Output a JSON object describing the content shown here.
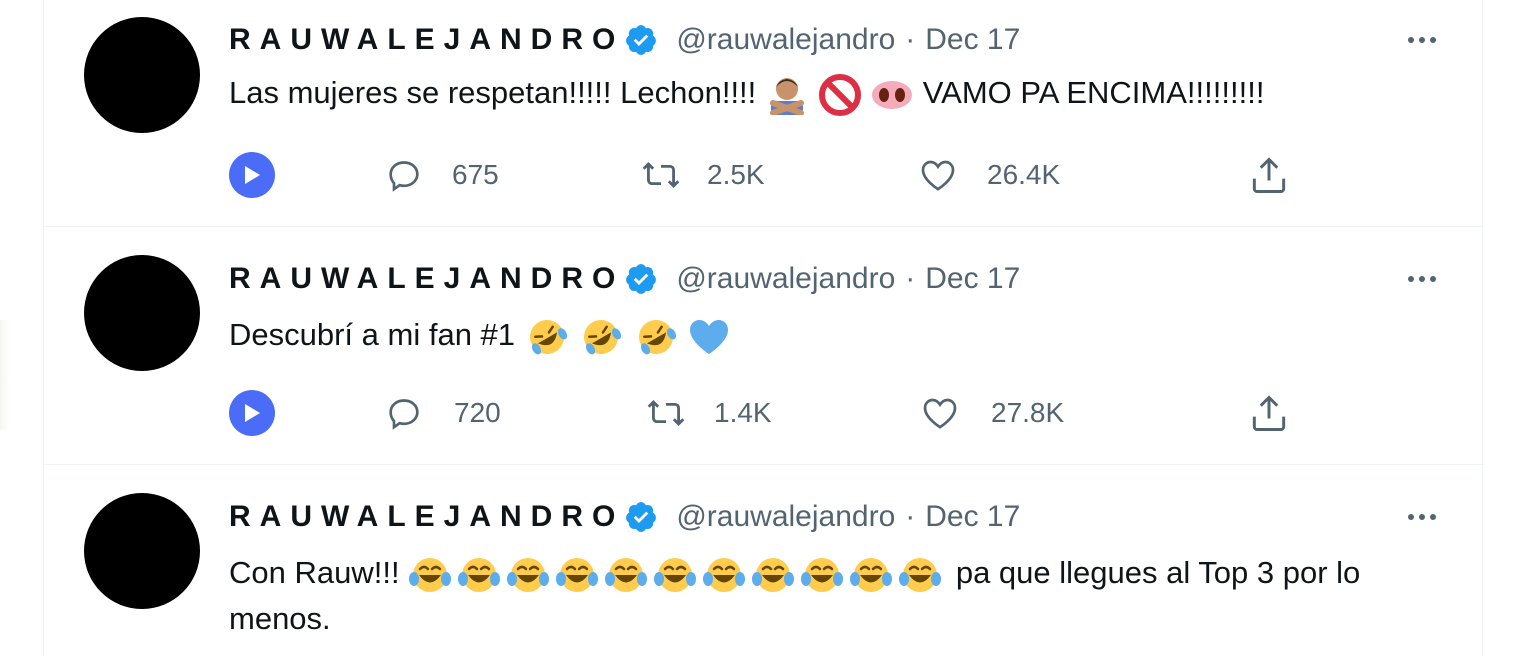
{
  "tweets": [
    {
      "name": "RAUWALEJANDRO",
      "handle": "@rauwalejandro",
      "separator": "·",
      "date": "Dec 17",
      "text_before": "Las mujeres se respetan!!!!! Lechon!!!!",
      "emojis": [
        "person-gesturing-no-emoji",
        "prohibited-emoji",
        "pig-nose-emoji"
      ],
      "text_after": "VAMO PA ENCIMA!!!!!!!!!",
      "replies": "675",
      "retweets": "2.5K",
      "likes": "26.4K"
    },
    {
      "name": "RAUWALEJANDRO",
      "handle": "@rauwalejandro",
      "separator": "·",
      "date": "Dec 17",
      "text_before": "Descubrí a mi fan #1",
      "emojis": [
        "rofl-emoji",
        "rofl-emoji",
        "rofl-emoji",
        "blue-heart-emoji"
      ],
      "replies": "720",
      "retweets": "1.4K",
      "likes": "27.8K"
    },
    {
      "name": "RAUWALEJANDRO",
      "handle": "@rauwalejandro",
      "separator": "·",
      "date": "Dec 17",
      "text_before": "Con Rauw!!!",
      "emojis": [
        "tears-of-joy-emoji",
        "tears-of-joy-emoji",
        "tears-of-joy-emoji",
        "tears-of-joy-emoji",
        "tears-of-joy-emoji",
        "tears-of-joy-emoji",
        "tears-of-joy-emoji",
        "tears-of-joy-emoji",
        "tears-of-joy-emoji",
        "tears-of-joy-emoji",
        "tears-of-joy-emoji"
      ],
      "text_after": "pa que llegues al Top 3 por lo menos."
    }
  ],
  "colors": {
    "verified": "#1d9bf0",
    "play_button": "#4a6cf7",
    "secondary_text": "#536471",
    "divider": "#eff3f4"
  }
}
